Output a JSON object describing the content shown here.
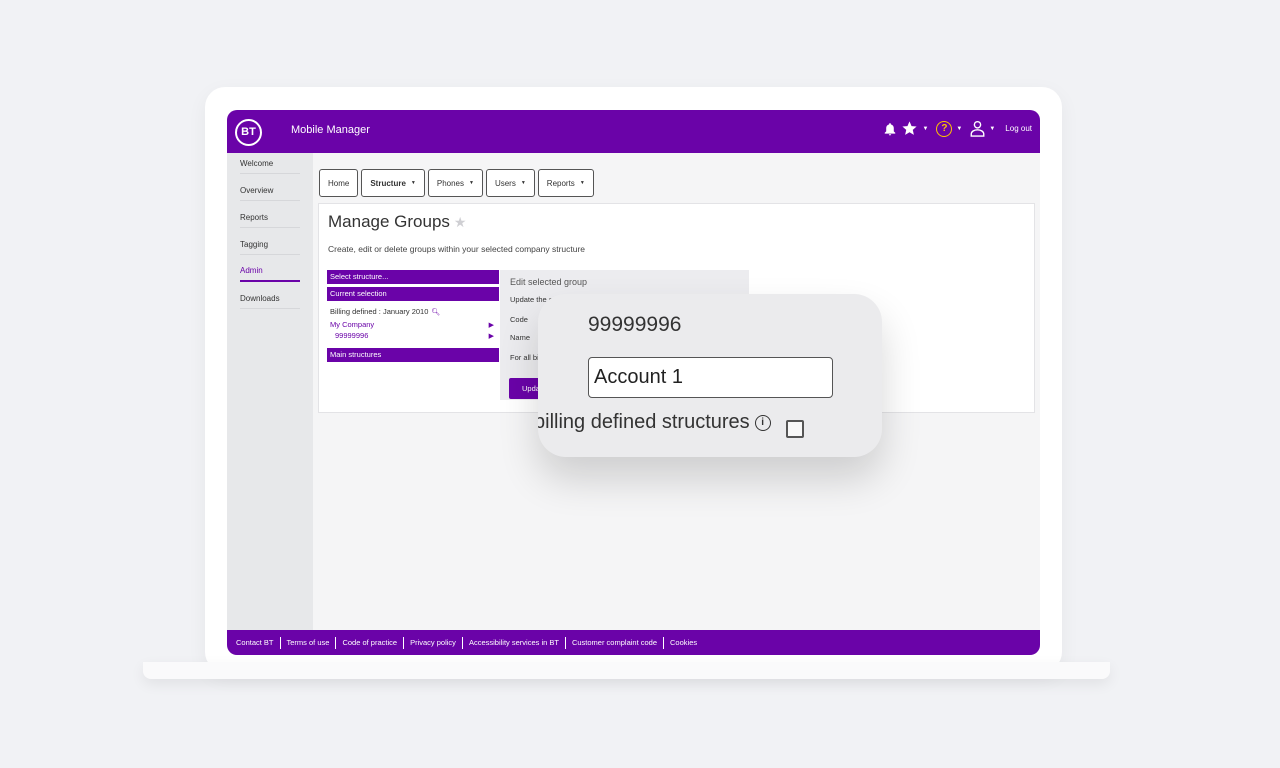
{
  "header": {
    "logo": "BT",
    "title": "Mobile Manager",
    "logout_label": "Log out",
    "help_glyph": "?"
  },
  "sidebar": {
    "items": [
      {
        "label": "Welcome"
      },
      {
        "label": "Overview"
      },
      {
        "label": "Reports"
      },
      {
        "label": "Tagging"
      },
      {
        "label": "Admin",
        "active": true
      },
      {
        "label": "Downloads"
      }
    ]
  },
  "tabs": [
    {
      "label": "Home"
    },
    {
      "label": "Structure"
    },
    {
      "label": "Phones"
    },
    {
      "label": "Users"
    },
    {
      "label": "Reports"
    }
  ],
  "page": {
    "title": "Manage Groups",
    "description": "Create, edit or delete groups within your selected company structure"
  },
  "structure_panel": {
    "select_structure": "Select structure...",
    "current_selection": "Current selection",
    "billing_defined": "Billing defined : January 2010",
    "company": "My Company",
    "account_code": "99999996",
    "main_structures": "Main structures"
  },
  "edit_panel": {
    "title": "Edit selected group",
    "update_text": "Update the c",
    "code_label": "Code",
    "name_label": "Name",
    "for_all_text": "For all bi",
    "update_button": "Upda"
  },
  "zoom": {
    "code_value": "99999996",
    "name_value": "Account 1",
    "checkbox_label": "billing defined structures",
    "checkbox_checked": false
  },
  "footer": {
    "links": [
      "Contact BT",
      "Terms of use",
      "Code of practice",
      "Privacy policy",
      "Accessibility services in BT",
      "Customer complaint code",
      "Cookies"
    ]
  },
  "colors": {
    "brand_purple": "#6a03a8",
    "help_yellow": "#ffc300"
  },
  "icons": [
    "bell-icon",
    "star-icon",
    "help-icon",
    "user-icon",
    "search-icon",
    "chevron-down-icon",
    "arrow-right-icon",
    "info-icon"
  ]
}
